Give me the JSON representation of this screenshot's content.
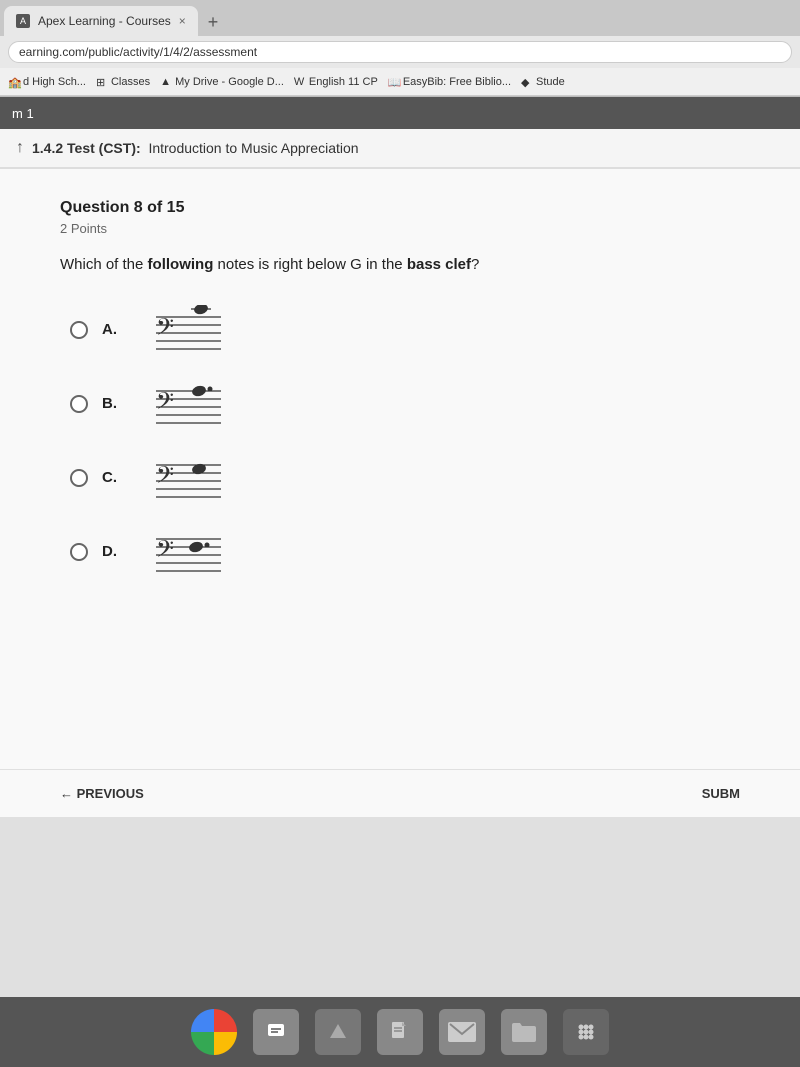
{
  "browser": {
    "tab_title": "Apex Learning - Courses",
    "tab_close": "×",
    "tab_new": "+",
    "address": "earning.com/public/activity/1/4/2/assessment",
    "bookmarks": [
      {
        "label": "d High Sch...",
        "icon": "school"
      },
      {
        "label": "Classes",
        "icon": "grid"
      },
      {
        "label": "My Drive - Google D...",
        "icon": "drive"
      },
      {
        "label": "English 11 CP",
        "icon": "doc"
      },
      {
        "label": "EasyBib: Free Biblio...",
        "icon": "book"
      },
      {
        "label": "Stude",
        "icon": "star"
      }
    ]
  },
  "page_nav": {
    "label": "m 1"
  },
  "content_header": {
    "arrow_icon": "↑",
    "title": "1.4.2 Test (CST):",
    "subtitle": "Introduction to Music Appreciation"
  },
  "question": {
    "header": "Question 8 of 15",
    "points": "2 Points",
    "text": "Which of the following notes is right below G in the bass clef?"
  },
  "options": [
    {
      "id": "A",
      "label": "A."
    },
    {
      "id": "B",
      "label": "B."
    },
    {
      "id": "C",
      "label": "C."
    },
    {
      "id": "D",
      "label": "D."
    }
  ],
  "footer": {
    "previous": "← PREVIOUS",
    "submit": "SUBM"
  },
  "taskbar": {
    "icons": [
      "chrome",
      "person",
      "drive",
      "docs",
      "gmail",
      "folder",
      "dots"
    ]
  }
}
